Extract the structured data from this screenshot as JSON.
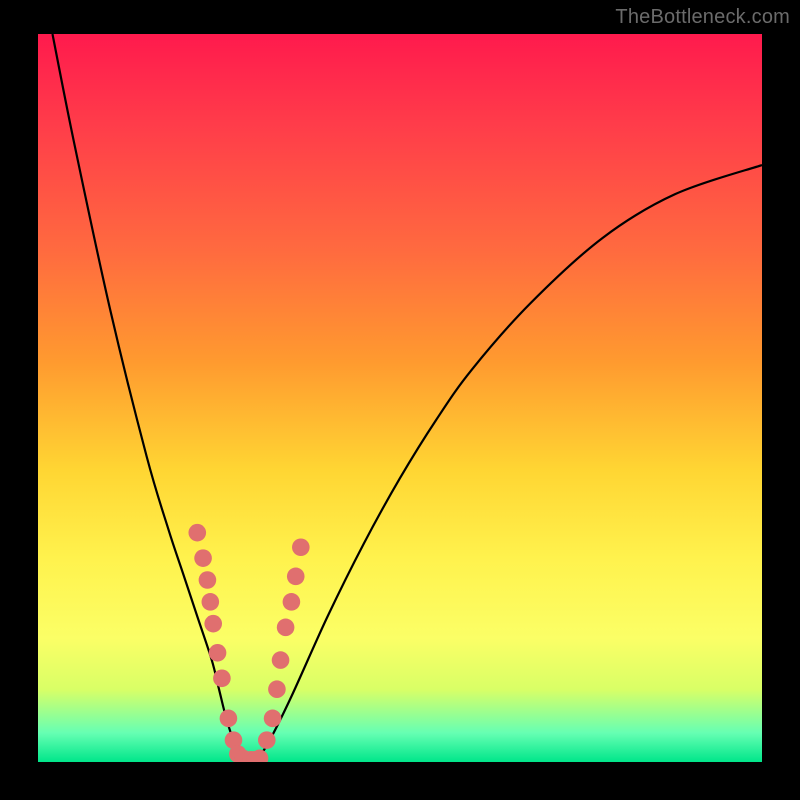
{
  "watermark": "TheBottleneck.com",
  "colors": {
    "dot": "#e06f6f",
    "curve": "#000000",
    "frame": "#000000"
  },
  "chart_data": {
    "type": "line",
    "xlim": [
      0,
      100
    ],
    "ylim": [
      0,
      100
    ],
    "title": "",
    "xlabel": "",
    "ylabel": "",
    "grid": false,
    "legend": false,
    "series": [
      {
        "name": "bottleneck-curve",
        "x": [
          2,
          5,
          10,
          15,
          18,
          20,
          22,
          24,
          25,
          26,
          27,
          28,
          29,
          30,
          32,
          35,
          40,
          45,
          50,
          55,
          60,
          68,
          78,
          88,
          100
        ],
        "y": [
          100,
          85,
          62,
          42,
          32,
          26,
          20,
          14,
          10,
          6,
          3,
          1,
          0,
          0,
          3,
          9,
          20,
          30,
          39,
          47,
          54,
          63,
          72,
          78,
          82
        ]
      }
    ],
    "markers": {
      "name": "highlight-dots",
      "x": [
        22.0,
        22.8,
        23.4,
        23.8,
        24.2,
        24.8,
        25.4,
        26.3,
        27.0,
        27.6,
        28.3,
        29.4,
        30.0,
        30.6,
        31.6,
        32.4,
        33.0,
        33.5,
        34.2,
        35.0,
        35.6,
        36.3
      ],
      "y": [
        31.5,
        28.0,
        25.0,
        22.0,
        19.0,
        15.0,
        11.5,
        6.0,
        3.0,
        1.1,
        0.5,
        0.3,
        0.3,
        0.5,
        3.0,
        6.0,
        10.0,
        14.0,
        18.5,
        22.0,
        25.5,
        29.5
      ]
    }
  }
}
